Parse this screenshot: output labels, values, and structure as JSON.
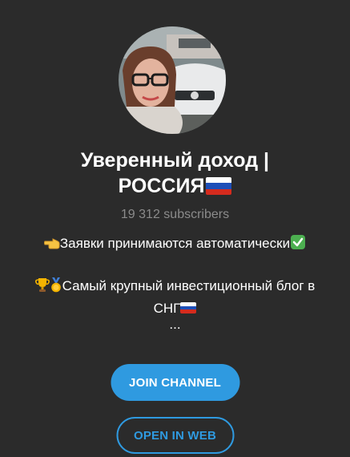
{
  "channel": {
    "title_line1": "Уверенный доход |",
    "title_line2": "РОССИЯ",
    "subscribers": "19 312 subscribers"
  },
  "description": {
    "line1": "Заявки принимаются автоматически",
    "line2": "Самый крупный инвестиционный блог в",
    "line3": "СНГ",
    "ellipsis": "..."
  },
  "buttons": {
    "join_label": "JOIN CHANNEL",
    "web_label": "OPEN IN WEB"
  },
  "icons": {
    "avatar": "channel-avatar-photo",
    "flag": "russia-flag-icon",
    "pointing": "pointing-hand-icon",
    "check": "check-mark-icon",
    "trophy": "trophy-icon",
    "medal": "gold-medal-icon"
  },
  "colors": {
    "background": "#2b2b2b",
    "accent": "#2f9ae0",
    "muted_text": "#8b8b8b"
  }
}
